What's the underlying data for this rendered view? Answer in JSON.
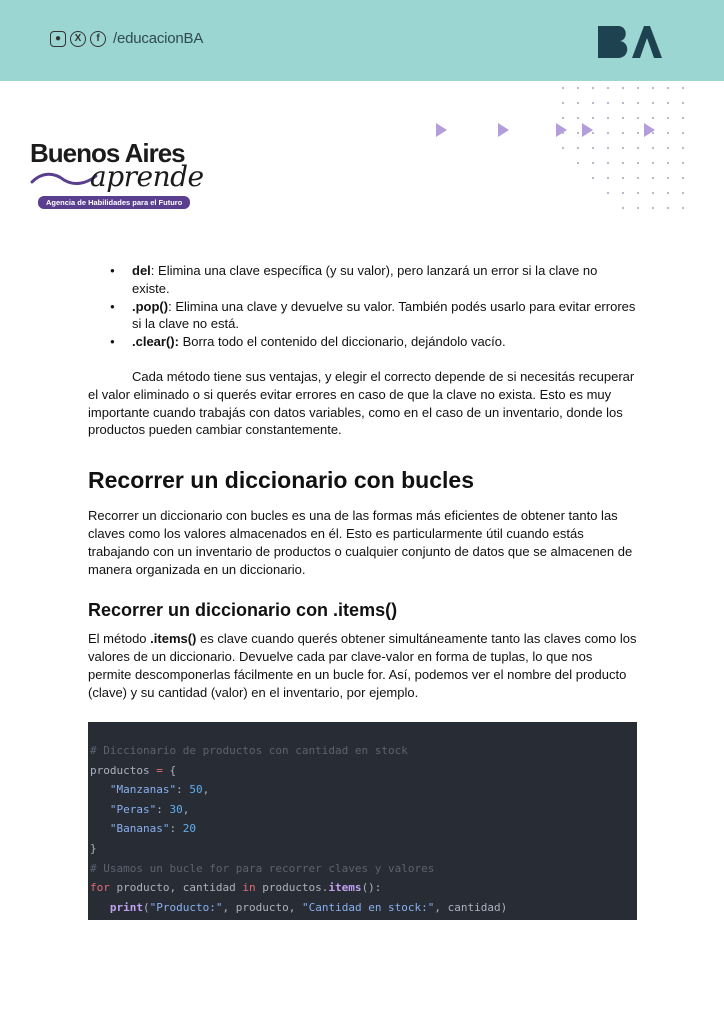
{
  "header": {
    "handle": "/educacionBA",
    "social_icons": [
      "instagram-icon",
      "x-icon",
      "facebook-icon"
    ],
    "brand_logo": "BA",
    "background_color": "#9cd6d2"
  },
  "logo": {
    "title": "Buenos Aires",
    "script": "aprende",
    "tagline": "Agencia de Habilidades para el Futuro",
    "accent_color": "#5b3f8f"
  },
  "bullets": [
    {
      "term": "del",
      "text": ": Elimina una clave específica (y su valor), pero lanzará un error si la clave no existe."
    },
    {
      "term": ".pop()",
      "text": ": Elimina una clave y devuelve su valor. También podés usarlo para evitar errores si la clave no está."
    },
    {
      "term": ".clear():",
      "text": " Borra todo el contenido del diccionario, dejándolo vacío."
    }
  ],
  "paragraph1": "Cada método tiene sus ventajas, y elegir el correcto depende de si necesitás recuperar el valor eliminado o si querés evitar errores en caso de que la clave no exista. Esto es muy importante cuando trabajás con datos variables, como en el caso de un inventario, donde los productos pueden cambiar constantemente.",
  "heading1": "Recorrer un diccionario con bucles",
  "paragraph2": "Recorrer un diccionario con bucles es una de las formas más eficientes de obtener tanto las claves como los valores almacenados en él. Esto es particularmente útil cuando estás trabajando con un inventario de productos o cualquier conjunto de datos que se almacenen de manera organizada en un diccionario.",
  "heading2": "Recorrer un diccionario con .items()",
  "paragraph3": {
    "pre": "El método ",
    "term": ".items()",
    "post": " es clave cuando querés obtener simultáneamente tanto las claves como los valores de un diccionario. Devuelve cada par clave-valor en forma de tuplas, lo que nos permite descomponerlas fácilmente en un bucle for. Así, podemos ver el nombre del producto (clave) y su cantidad (valor) en el inventario, por ejemplo."
  },
  "code": {
    "comment1": "# Diccionario de productos con cantidad en stock",
    "dict_name": "productos",
    "assign": " = ",
    "open_brace": "{",
    "entries": [
      {
        "key": "\"Manzanas\"",
        "value": "50",
        "comma": ","
      },
      {
        "key": "\"Peras\"",
        "value": "30",
        "comma": ","
      },
      {
        "key": "\"Bananas\"",
        "value": "20",
        "comma": ""
      }
    ],
    "close_brace": "}",
    "comment2": "# Usamos un bucle for para recorrer claves y valores",
    "for_kw": "for",
    "loop_vars": " producto, cantidad ",
    "in_kw": "in",
    "iter_obj": " productos.",
    "method": "items",
    "loop_end": "():",
    "print_fn": "print",
    "print_open": "(",
    "print_str1": "\"Producto:\"",
    "print_mid": ", producto, ",
    "print_str2": "\"Cantidad en stock:\"",
    "print_end": ", cantidad)"
  }
}
